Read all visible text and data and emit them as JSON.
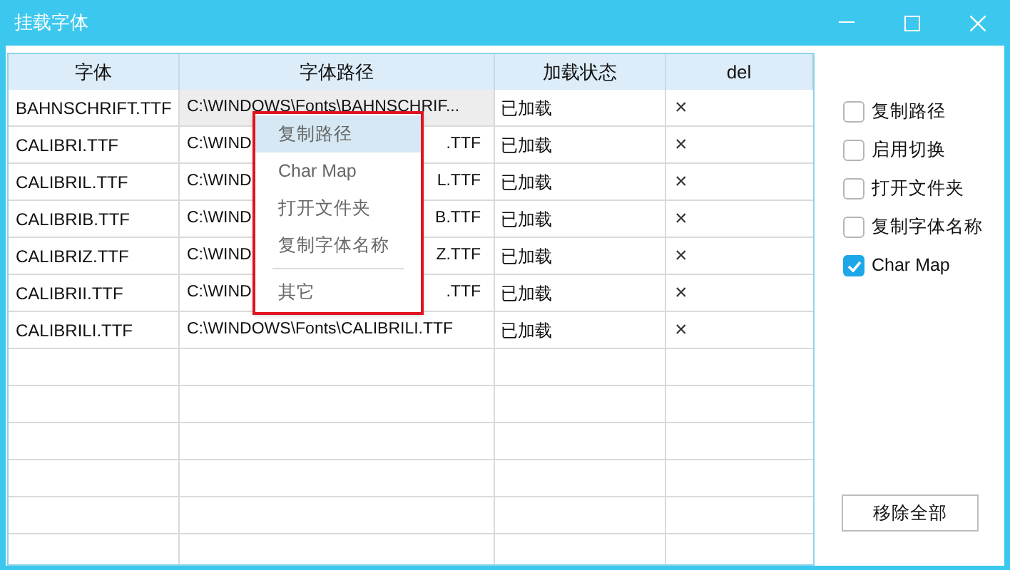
{
  "window": {
    "title": "挂载字体"
  },
  "table": {
    "columns": [
      "字体",
      "字体路径",
      "加载状态",
      "del"
    ],
    "rows": [
      {
        "font": "BAHNSCHRIFT.TTF",
        "path": "C:\\WINDOWS\\Fonts\\BAHNSCHRIF...",
        "status": "已加载",
        "del": "×",
        "selected": true
      },
      {
        "font": "CALIBRI.TTF",
        "path": "C:\\WIND",
        "path_end": ".TTF",
        "status": "已加载",
        "del": "×",
        "selected": false
      },
      {
        "font": "CALIBRIL.TTF",
        "path": "C:\\WIND",
        "path_end": "L.TTF",
        "status": "已加载",
        "del": "×",
        "selected": false
      },
      {
        "font": "CALIBRIB.TTF",
        "path": "C:\\WIND",
        "path_end": "B.TTF",
        "status": "已加载",
        "del": "×",
        "selected": false
      },
      {
        "font": "CALIBRIZ.TTF",
        "path": "C:\\WIND",
        "path_end": "Z.TTF",
        "status": "已加载",
        "del": "×",
        "selected": false
      },
      {
        "font": "CALIBRII.TTF",
        "path": "C:\\WIND",
        "path_end": ".TTF",
        "status": "已加载",
        "del": "×",
        "selected": false
      },
      {
        "font": "CALIBRILI.TTF",
        "path": "C:\\WINDOWS\\Fonts\\CALIBRILI.TTF",
        "status": "已加载",
        "del": "×",
        "selected": false
      }
    ]
  },
  "context_menu": {
    "items": [
      {
        "label": "复制路径",
        "selected": true,
        "separator_before": false
      },
      {
        "label": "Char Map",
        "selected": false,
        "separator_before": false
      },
      {
        "label": "打开文件夹",
        "selected": false,
        "separator_before": false
      },
      {
        "label": "复制字体名称",
        "selected": false,
        "separator_before": false
      },
      {
        "label": "其它",
        "selected": false,
        "separator_before": true
      }
    ]
  },
  "options": [
    {
      "label": "复制路径",
      "checked": false
    },
    {
      "label": "启用切换",
      "checked": false
    },
    {
      "label": "打开文件夹",
      "checked": false
    },
    {
      "label": "复制字体名称",
      "checked": false
    },
    {
      "label": "Char Map",
      "checked": true
    }
  ],
  "remove_all_button": "移除全部"
}
